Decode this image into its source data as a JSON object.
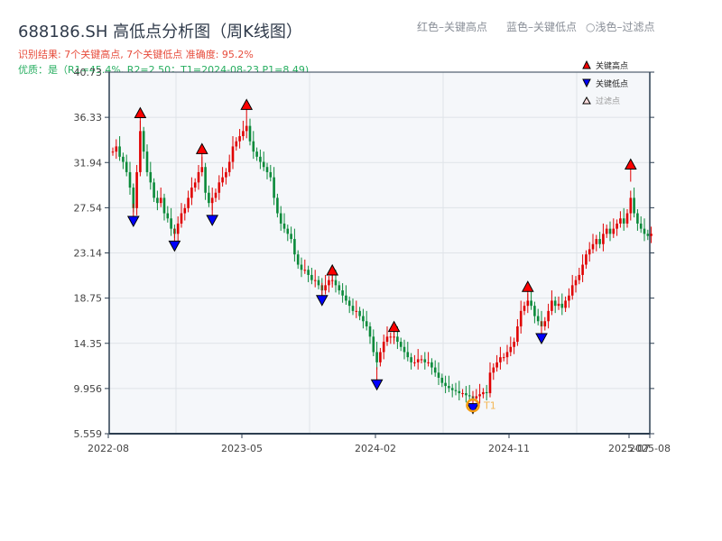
{
  "header": {
    "title": "688186.SH 高低点分析图（周K线图）",
    "result": "识别结果: 7个关键高点, 7个关键低点  准确度: 95.2%",
    "quality": "优质：是（R1=45.4%, R2=2.50；T1=2024-08-23 P1=8.49)",
    "legend_red": "红色–关键高点",
    "legend_blue": "蓝色–关键低点",
    "legend_light": "○浅色–过滤点"
  },
  "chart_data": {
    "type": "candlestick",
    "yticks": [
      "5.559",
      "9.956",
      "14.35",
      "18.75",
      "23.14",
      "27.54",
      "31.94",
      "36.33",
      "40.73"
    ],
    "ylim": [
      5.559,
      40.73
    ],
    "xticks": [
      "2022-08",
      "2023-05",
      "2024-02",
      "2024-11",
      "2025-07",
      "2025-08"
    ],
    "grid": true,
    "legend": {
      "position": "top-right",
      "items": [
        "关键高点",
        "关键低点",
        "过滤点"
      ]
    },
    "closes": [
      33,
      33.5,
      32.5,
      32,
      31,
      29.5,
      27.5,
      31,
      35,
      33,
      31,
      30,
      28.5,
      28,
      28.5,
      27,
      26.5,
      25.5,
      25,
      26,
      27,
      27.5,
      28.5,
      29.5,
      30,
      31,
      31.5,
      29,
      28,
      28.5,
      29,
      30,
      30.5,
      31,
      32,
      33.5,
      34,
      34.5,
      35,
      35.5,
      34,
      33,
      32.5,
      32,
      31.5,
      31,
      30.5,
      28.5,
      27,
      26,
      25.5,
      25,
      24.5,
      23,
      22,
      21.5,
      21.5,
      21,
      20.5,
      20.5,
      20,
      19.5,
      20,
      20.5,
      20.5,
      20,
      19.5,
      19,
      18.5,
      18,
      17.5,
      17.5,
      17,
      16.5,
      16,
      15,
      13.5,
      12.5,
      13.5,
      14.5,
      15,
      15,
      15,
      14.5,
      14,
      13.5,
      13,
      12.5,
      12.5,
      12.8,
      12.8,
      12.5,
      12.5,
      12,
      11.5,
      11,
      10.5,
      10.2,
      10,
      9.8,
      9.7,
      9.5,
      9.5,
      9.3,
      9.2,
      9,
      9.2,
      9.4,
      9.6,
      9.5,
      11.5,
      12,
      12.5,
      13,
      13,
      13.5,
      14,
      14.5,
      16,
      17.5,
      18,
      18.5,
      18,
      17,
      16.5,
      16,
      16.5,
      17.5,
      18.5,
      18,
      18.2,
      17.8,
      18.5,
      19,
      20,
      20.5,
      21,
      22,
      23,
      23.5,
      24,
      24.5,
      24,
      25,
      25.5,
      25,
      25.5,
      26,
      26.5,
      26,
      27,
      28.5,
      27,
      26,
      25.5,
      25,
      24.8,
      25
    ],
    "key_highs": [
      {
        "date": "2022-10-14",
        "price": 36.3
      },
      {
        "date": "2023-02-17",
        "price": 32.8
      },
      {
        "date": "2023-05-19",
        "price": 37.1
      },
      {
        "date": "2023-11-10",
        "price": 21.0
      },
      {
        "date": "2024-03-15",
        "price": 15.5
      },
      {
        "date": "2024-12-13",
        "price": 19.4
      },
      {
        "date": "2025-07-11",
        "price": 31.3
      }
    ],
    "key_lows": [
      {
        "date": "2022-09-30",
        "price": 26.7
      },
      {
        "date": "2022-12-23",
        "price": 24.3
      },
      {
        "date": "2023-03-10",
        "price": 26.8
      },
      {
        "date": "2023-10-20",
        "price": 19.0
      },
      {
        "date": "2024-02-09",
        "price": 10.8
      },
      {
        "date": "2024-08-23",
        "price": 8.49
      },
      {
        "date": "2025-01-10",
        "price": 15.3
      }
    ],
    "t1": {
      "label": "T1",
      "date": "2024-08-23",
      "price": 8.49
    },
    "colors": {
      "up": "#e00000",
      "down": "#0a8a3a",
      "high": "#ff0000",
      "low": "#0000ff",
      "t1": "#f39c12"
    }
  }
}
